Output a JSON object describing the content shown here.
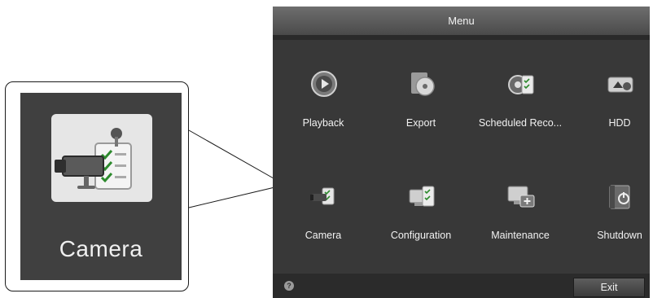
{
  "window": {
    "title": "Menu"
  },
  "menu_items": [
    {
      "label": "Playback",
      "icon": "playback-icon"
    },
    {
      "label": "Export",
      "icon": "export-disc-icon"
    },
    {
      "label": "Scheduled Reco...",
      "icon": "scheduled-record-icon"
    },
    {
      "label": "HDD",
      "icon": "hdd-icon"
    },
    {
      "label": "Camera",
      "icon": "camera-icon"
    },
    {
      "label": "Configuration",
      "icon": "configuration-icon"
    },
    {
      "label": "Maintenance",
      "icon": "maintenance-icon"
    },
    {
      "label": "Shutdown",
      "icon": "shutdown-icon"
    }
  ],
  "bottom_bar": {
    "help_glyph": "?",
    "exit_label": "Exit"
  },
  "callout": {
    "label": "Camera",
    "icon": "camera-icon"
  }
}
